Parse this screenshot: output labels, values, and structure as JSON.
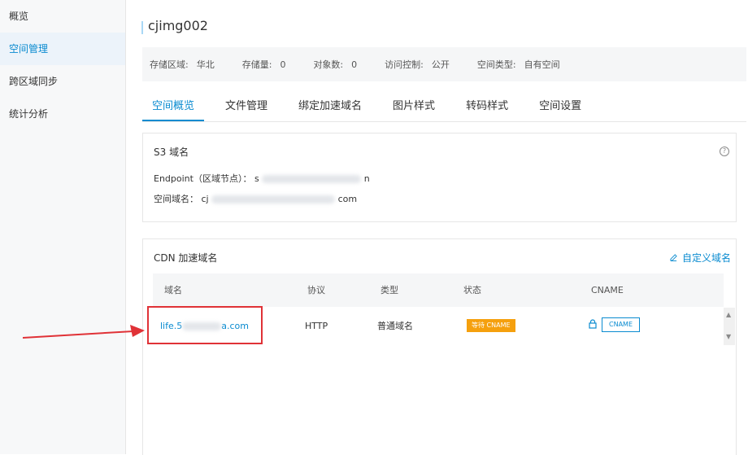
{
  "sidebar": {
    "items": [
      {
        "label": "概览"
      },
      {
        "label": "空间管理"
      },
      {
        "label": "跨区域同步"
      },
      {
        "label": "统计分析"
      }
    ]
  },
  "bucket": {
    "name": "cjimg002"
  },
  "info": {
    "region_label": "存储区域:",
    "region_value": "华北",
    "storage_label": "存储量:",
    "storage_value": "0",
    "objects_label": "对象数:",
    "objects_value": "0",
    "access_label": "访问控制:",
    "access_value": "公开",
    "type_label": "空间类型:",
    "type_value": "自有空间"
  },
  "tabs": [
    {
      "label": "空间概览"
    },
    {
      "label": "文件管理"
    },
    {
      "label": "绑定加速域名"
    },
    {
      "label": "图片样式"
    },
    {
      "label": "转码样式"
    },
    {
      "label": "空间设置"
    }
  ],
  "s3": {
    "title": "S3 域名",
    "endpoint_label": "Endpoint（区域节点）：",
    "endpoint_prefix": "s",
    "endpoint_suffix": "n",
    "bucket_domain_label": "空间域名：",
    "bucket_domain_prefix": "cj",
    "bucket_domain_suffix": "com",
    "help": "?"
  },
  "cdn": {
    "title": "CDN 加速域名",
    "custom_domain": "自定义域名",
    "columns": [
      "域名",
      "协议",
      "类型",
      "状态",
      "CNAME"
    ],
    "rows": [
      {
        "domain_prefix": "life.5",
        "domain_suffix": "a.com",
        "protocol": "HTTP",
        "type": "普通域名",
        "status": "等待 CNAME",
        "cname_button": "CNAME"
      }
    ]
  },
  "colors": {
    "accent": "#0a8bd0",
    "status_warning": "#f5a00e",
    "highlight": "#e03237"
  }
}
